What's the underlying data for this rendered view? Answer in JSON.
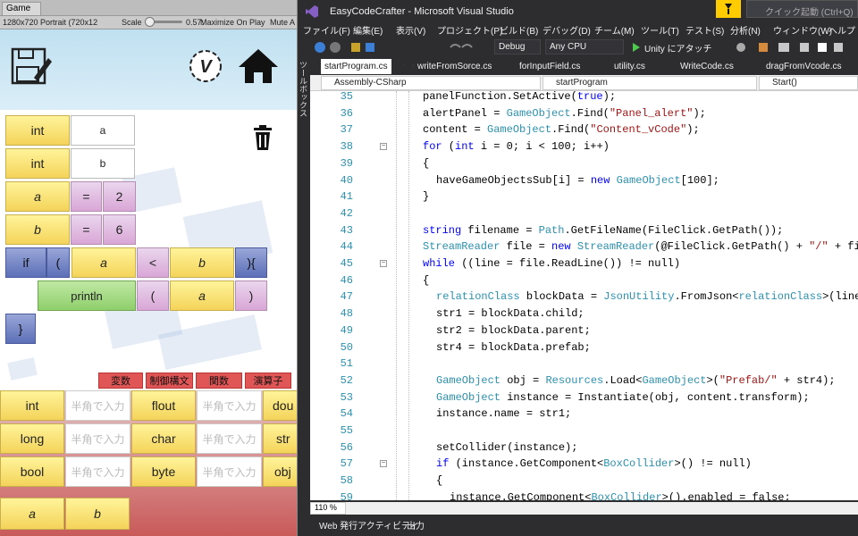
{
  "unity": {
    "tab_label": "Game",
    "resolution": "1280x720 Portrait (720x12",
    "scale_label": "Scale",
    "scale_value": "0.57:",
    "maximize_on_play": "Maximize On Play",
    "mute": "Mute A",
    "canvas": {
      "var_rows": [
        {
          "type": "int",
          "name": "a"
        },
        {
          "type": "int",
          "name": "b"
        }
      ],
      "assign_rows": [
        {
          "var": "a",
          "op": "=",
          "val": "2"
        },
        {
          "var": "b",
          "op": "=",
          "val": "6"
        }
      ],
      "if_row": {
        "kw": "if",
        "open": "(",
        "lhs": "a",
        "cmp": "<",
        "rhs": "b",
        "close": "){"
      },
      "println_row": {
        "fn": "println",
        "open": "(",
        "arg": "a",
        "close": ")"
      },
      "close_brace": "}"
    },
    "tabs": [
      "変数",
      "制御構文",
      "関数",
      "演算子"
    ],
    "palette": {
      "rows": [
        {
          "type1": "int",
          "ph1": "半角で入力",
          "type2": "flout",
          "ph2": "半角で入力",
          "type3": "dou"
        },
        {
          "type1": "long",
          "ph1": "半角で入力",
          "type2": "char",
          "ph2": "半角で入力",
          "type3": "str"
        },
        {
          "type1": "bool",
          "ph1": "半角で入力",
          "type2": "byte",
          "ph2": "半角で入力",
          "type3": "obj"
        }
      ],
      "vars": [
        "a",
        "b"
      ]
    },
    "logo_letter": "V"
  },
  "vs": {
    "title": "EasyCodeCrafter - Microsoft Visual Studio",
    "search_placeholder": "クイック起動 (Ctrl+Q)",
    "menu": [
      "ファイル(F)",
      "編集(E)",
      "表示(V)",
      "プロジェクト(P)",
      "ビルド(B)",
      "デバッグ(D)",
      "チーム(M)",
      "ツール(T)",
      "テスト(S)",
      "分析(N)",
      "ウィンドウ(W)",
      "ヘルプ"
    ],
    "toolbar": {
      "config": "Debug",
      "platform": "Any CPU",
      "attach": "Unity にアタッチ"
    },
    "side_toolbox": "ツールボックス",
    "file_tabs": [
      "startProgram.cs",
      "writeFromSorce.cs",
      "forInputField.cs",
      "utility.cs",
      "WriteCode.cs",
      "dragFromVcode.cs"
    ],
    "nav": {
      "project": "Assembly-CSharp",
      "class": "startProgram",
      "member": "Start()"
    },
    "zoom": "110 %",
    "bottom_tabs": [
      "Web 発行アクティビティ",
      "出力"
    ]
  },
  "code_lines": [
    {
      "n": "35",
      "i": 0,
      "t": "panelFunction.SetActive(true);"
    },
    {
      "n": "36",
      "i": 0,
      "t": "alertPanel = GameObject.Find(\"Panel_alert\");"
    },
    {
      "n": "37",
      "i": 0,
      "t": "content = GameObject.Find(\"Content_vCode\");"
    },
    {
      "n": "38",
      "i": 0,
      "t": "for (int i = 0; i < 100; i++)"
    },
    {
      "n": "39",
      "i": 0,
      "t": "{"
    },
    {
      "n": "40",
      "i": 1,
      "t": "haveGameObjectsSub[i] = new GameObject[100];"
    },
    {
      "n": "41",
      "i": 0,
      "t": "}"
    },
    {
      "n": "42",
      "i": 0,
      "t": ""
    },
    {
      "n": "43",
      "i": 0,
      "t": "string filename = Path.GetFileName(FileClick.GetPath());"
    },
    {
      "n": "44",
      "i": 0,
      "t": "StreamReader file = new StreamReader(@FileClick.GetPath() + \"/\" + filename + \".json"
    },
    {
      "n": "45",
      "i": 0,
      "t": "while ((line = file.ReadLine()) != null)"
    },
    {
      "n": "46",
      "i": 0,
      "t": "{"
    },
    {
      "n": "47",
      "i": 1,
      "t": "relationClass blockData = JsonUtility.FromJson<relationClass>(line);"
    },
    {
      "n": "48",
      "i": 1,
      "t": "str1 = blockData.child;"
    },
    {
      "n": "49",
      "i": 1,
      "t": "str2 = blockData.parent;"
    },
    {
      "n": "50",
      "i": 1,
      "t": "str4 = blockData.prefab;"
    },
    {
      "n": "51",
      "i": 0,
      "t": ""
    },
    {
      "n": "52",
      "i": 1,
      "t": "GameObject obj = Resources.Load<GameObject>(\"Prefab/\" + str4);"
    },
    {
      "n": "53",
      "i": 1,
      "t": "GameObject instance = Instantiate(obj, content.transform);"
    },
    {
      "n": "54",
      "i": 1,
      "t": "instance.name = str1;"
    },
    {
      "n": "55",
      "i": 0,
      "t": ""
    },
    {
      "n": "56",
      "i": 1,
      "t": "setCollider(instance);"
    },
    {
      "n": "57",
      "i": 1,
      "t": "if (instance.GetComponent<BoxCollider>() != null)"
    },
    {
      "n": "58",
      "i": 1,
      "t": "{"
    },
    {
      "n": "59",
      "i": 2,
      "t": "instance.GetComponent<BoxCollider>().enabled = false;"
    }
  ]
}
